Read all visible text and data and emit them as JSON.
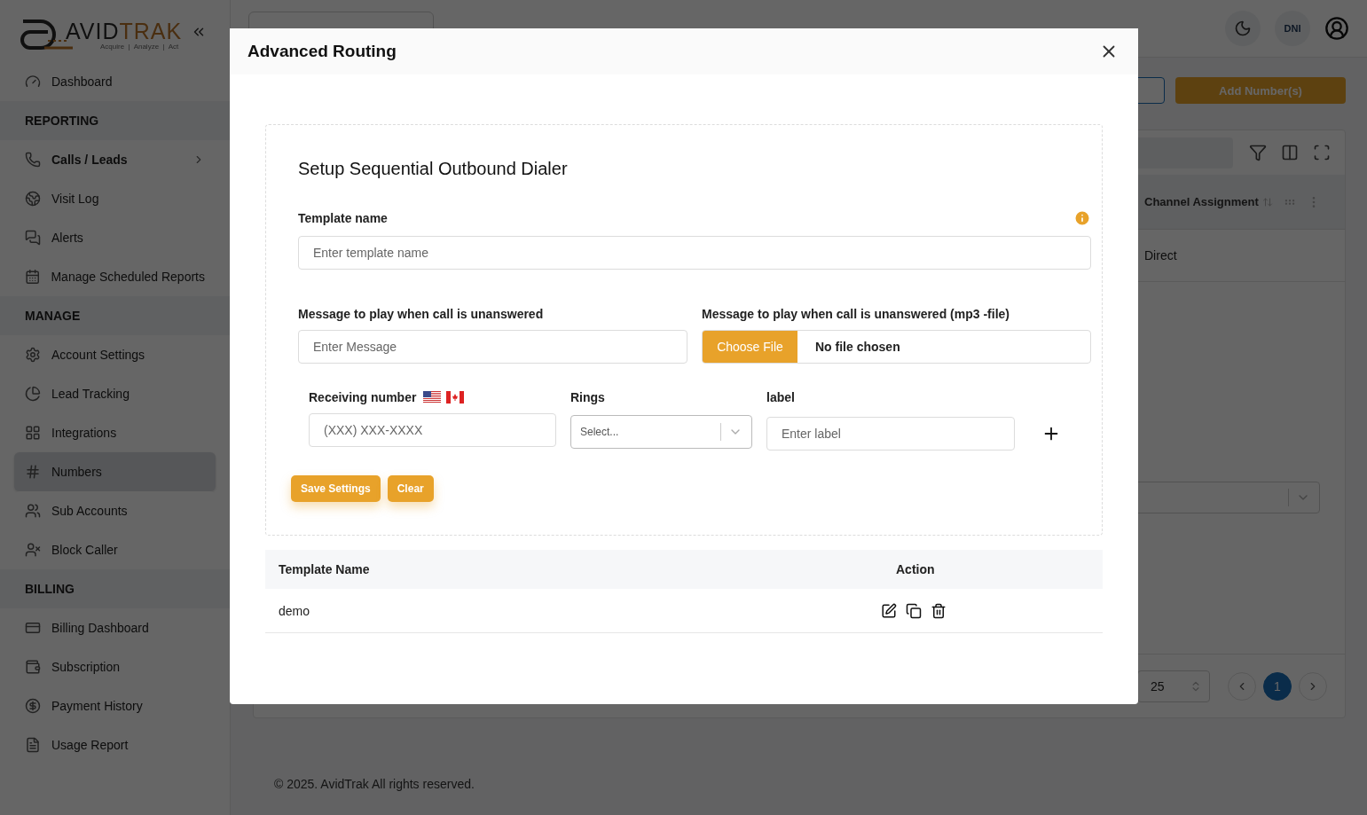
{
  "sidebar": {
    "logo": {
      "wordmark": [
        "AVID",
        "TRAK"
      ],
      "tagline": "Acquire  |  Analyze  |  Act"
    },
    "sections": [
      {
        "items": [
          {
            "label": "Dashboard",
            "selected": false,
            "submenu": false
          }
        ]
      },
      {
        "title": "REPORTING",
        "items": [
          {
            "label": "Calls / Leads",
            "selected": false,
            "submenu": true
          },
          {
            "label": "Visit Log",
            "selected": false,
            "submenu": false
          },
          {
            "label": "Alerts",
            "selected": false,
            "submenu": false
          },
          {
            "label": "Manage Scheduled Reports",
            "selected": false,
            "submenu": false
          }
        ]
      },
      {
        "title": "MANAGE",
        "items": [
          {
            "label": "Account Settings",
            "selected": false,
            "submenu": false
          },
          {
            "label": "Lead Tracking",
            "selected": false,
            "submenu": false
          },
          {
            "label": "Integrations",
            "selected": false,
            "submenu": false
          },
          {
            "label": "Numbers",
            "selected": true,
            "submenu": false
          },
          {
            "label": "Sub Accounts",
            "selected": false,
            "submenu": false
          },
          {
            "label": "Block Caller",
            "selected": false,
            "submenu": false
          }
        ]
      },
      {
        "title": "BILLING",
        "items": [
          {
            "label": "Billing Dashboard",
            "selected": false,
            "submenu": false
          },
          {
            "label": "Subscription",
            "selected": false,
            "submenu": false
          },
          {
            "label": "Payment History",
            "selected": false,
            "submenu": false
          },
          {
            "label": "Usage Report",
            "selected": false,
            "submenu": false
          }
        ]
      }
    ]
  },
  "header": {
    "badge": "DNI"
  },
  "toolbar": {
    "add_button": "Add Number(s)"
  },
  "table": {
    "columns": [
      {
        "label": "Channel Assignment"
      }
    ],
    "rows": [
      [
        "Direct"
      ]
    ],
    "per_page": "25",
    "pages": [
      {
        "label": "1",
        "selected": true
      }
    ]
  },
  "footer": "© 2025. AvidTrak All rights reserved.",
  "modal": {
    "title": "Advanced Routing",
    "form": {
      "heading": "Setup Sequential Outbound Dialer",
      "template_name": {
        "label": "Template name",
        "placeholder": "Enter template name"
      },
      "message": {
        "label": "Message to play when call is unanswered",
        "placeholder": "Enter Message"
      },
      "message_file": {
        "label": "Message to play when call is unanswered (mp3 -file)",
        "button": "Choose File",
        "status": "No file chosen"
      },
      "receiving_number": {
        "label": "Receiving number",
        "placeholder": "(XXX) XXX-XXXX"
      },
      "rings": {
        "label": "Rings",
        "placeholder": "Select..."
      },
      "entry_label": {
        "label": "label",
        "placeholder": "Enter label"
      },
      "buttons": [
        "Save Settings",
        "Clear"
      ]
    },
    "templates": {
      "columns": [
        "Template Name",
        "Action"
      ],
      "rows": [
        {
          "name": "demo"
        }
      ]
    }
  }
}
